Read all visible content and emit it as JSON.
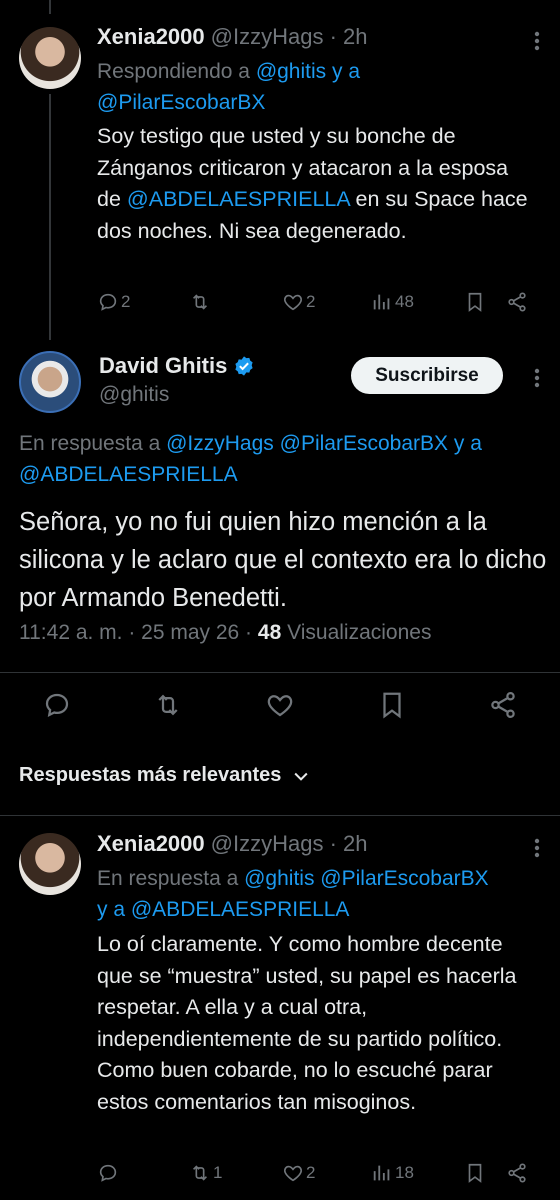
{
  "reply1": {
    "name": "Xenia2000",
    "handle": "@IzzyHags",
    "time": "· 2h",
    "reply_prefix": "Respondiendo a",
    "reply_mention1": "@ghitis",
    "reply_and": "y a",
    "reply_mention2": "@PilarEscobarBX",
    "body_1": "Soy testigo que usted y su bonche de Zánganos criticaron y atacaron a la esposa de",
    "body_mention": "@ABDELAESPRIELLA",
    "body_2": "en su Space hace dos noches. Ni sea degenerado.",
    "replies": "2",
    "likes": "2",
    "views": "48"
  },
  "main": {
    "name": "David Ghitis",
    "handle": "@ghitis",
    "subscribe_label": "Suscribirse",
    "reply_prefix": "En respuesta a",
    "reply_mention1": "@IzzyHags",
    "reply_mention2": "@PilarEscobarBX",
    "reply_and": "y a",
    "reply_mention3": "@ABDELAESPRIELLA",
    "body": "Señora, yo no fui quien hizo mención a la silicona y le aclaro que el contexto era lo dicho por Armando Benedetti.",
    "timestamp": "11:42 a. m. · 25 may 26 ·",
    "views_count": "48",
    "views_label": "Visualizaciones"
  },
  "sort": {
    "label": "Respuestas más relevantes"
  },
  "reply2": {
    "name": "Xenia2000",
    "handle": "@IzzyHags",
    "time": "· 2h",
    "reply_prefix": "En respuesta a",
    "reply_mention1": "@ghitis",
    "reply_mention2": "@PilarEscobarBX",
    "reply_and": "y a",
    "reply_mention3": "@ABDELAESPRIELLA",
    "body": "Lo oí claramente. Y como hombre decente que se “muestra” usted, su papel es hacerla respetar. A ella y a cual otra, independientemente de su partido político. Como buen cobarde, no lo escuché  parar estos comentarios tan misoginos.",
    "retweets": "1",
    "likes": "2",
    "views": "18"
  },
  "colors": {
    "accent": "#1d9bf0",
    "background": "#000000",
    "muted": "#71767b",
    "text": "#e7e9ea"
  }
}
